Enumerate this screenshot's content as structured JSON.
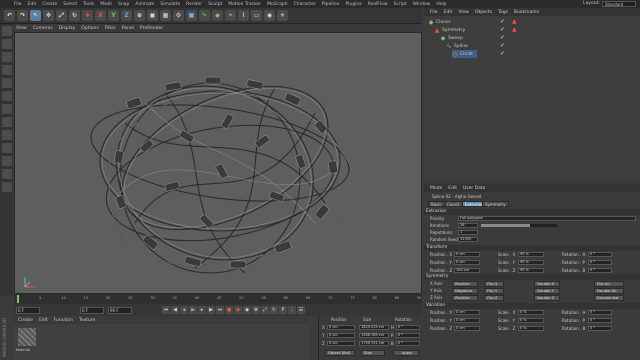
{
  "menubar": {
    "items": [
      "File",
      "Edit",
      "Create",
      "Select",
      "Tools",
      "Mesh",
      "Snap",
      "Animate",
      "Simulate",
      "Render",
      "Sculpt",
      "Motion Tracker",
      "MoGraph",
      "Character",
      "Pipeline",
      "Plugins",
      "RealFlow",
      "Script",
      "Window",
      "Help"
    ],
    "layout_label": "Layout:",
    "layout_value": "Standard"
  },
  "toolbar": {
    "axis_x": "X",
    "axis_y": "Y",
    "axis_z": "Z"
  },
  "viewport": {
    "menu": [
      "View",
      "Cameras",
      "Display",
      "Options",
      "Filter",
      "Panel",
      "ProRender"
    ]
  },
  "timeline": {
    "ticks": [
      "0",
      "5",
      "10",
      "15",
      "20",
      "25",
      "30",
      "35",
      "40",
      "45",
      "50",
      "55",
      "60",
      "65",
      "70",
      "75",
      "80",
      "85",
      "90"
    ],
    "start_field": "0 F",
    "end_field": "90 F",
    "current_frame": "0 F"
  },
  "material": {
    "menu": [
      "Create",
      "Edit",
      "Function",
      "Texture"
    ],
    "name": "Material"
  },
  "coordinates": {
    "headers": [
      "Position",
      "Size",
      "Rotation"
    ],
    "rows": [
      {
        "axis": "X",
        "pos": "0 cm",
        "size": "1829.215 cm",
        "rot_label": "H",
        "rot": "0 °"
      },
      {
        "axis": "Y",
        "pos": "0 cm",
        "size": "1306.785 cm",
        "rot_label": "P",
        "rot": "0 °"
      },
      {
        "axis": "Z",
        "pos": "0 cm",
        "size": "1759.722 cm",
        "rot_label": "B",
        "rot": "0 °"
      }
    ],
    "mode": "Object (Rel)",
    "size_mode": "Size",
    "apply": "Apply"
  },
  "objects": {
    "menu": [
      "File",
      "Edit",
      "View",
      "Objects",
      "Tags",
      "Bookmarks"
    ],
    "rows": [
      {
        "name": "Cloner",
        "color": "#7cc46a"
      },
      {
        "name": "Symmetry",
        "color": "#e6533b"
      },
      {
        "name": "Sweep",
        "color": "#7cc46a"
      },
      {
        "name": "Spline",
        "color": "#7cc46a"
      },
      {
        "name": "Circle",
        "color": "#e6a23b"
      }
    ]
  },
  "attributes": {
    "menu": [
      "Mode",
      "Edit",
      "User Data"
    ],
    "object_title": "Spline X2 - Alpha Owned",
    "tabs": [
      "Basic",
      "Coord.",
      "Extrusion",
      "Symmetry"
    ],
    "active_tab": "Extrusion",
    "extrusion": {
      "section": "Extrusion",
      "priority_label": "Priority",
      "priority_value": "Full polygons",
      "iterations_label": "Iterations",
      "iterations_value": "26",
      "repetitions_label": "Repetitions",
      "repetitions_value": "1",
      "random_seed_label": "Random Seed",
      "random_seed_value": "12359"
    },
    "transform": {
      "section": "Transform",
      "rows": [
        {
          "pos_label": "Position . X",
          "pos": "0 cm",
          "scale_label": "Scale . X",
          "scale": "95 %",
          "rot_label": "Rotation . H",
          "rot": "0 °"
        },
        {
          "pos_label": "Position . Y",
          "pos": "0 cm",
          "scale_label": "Scale . Y",
          "scale": "95 %",
          "rot_label": "Rotation . P",
          "rot": "0 °"
        },
        {
          "pos_label": "Position . Z",
          "pos": "100 cm",
          "scale_label": "Scale . Z",
          "scale": "95 %",
          "rot_label": "Rotation . B",
          "rot": "0 °"
        }
      ]
    },
    "symmetry": {
      "section": "Symmetry",
      "rows": [
        {
          "label": "X Axis",
          "opt": "Positive",
          "flip": "Flip X",
          "double": "Double X",
          "flip_all": "Flip All"
        },
        {
          "label": "Y Axis",
          "opt": "Negative",
          "flip": "Flip Y",
          "double": "Double Y",
          "flip_all": "Double All"
        },
        {
          "label": "Z Axis",
          "opt": "Positive",
          "flip": "Flip Z",
          "double": "Double Z",
          "flip_all": "Randomize"
        }
      ]
    },
    "variation": {
      "section": "Variation",
      "rows": [
        {
          "pos_label": "Position . X",
          "pos": "0 cm",
          "scale_label": "Scale . X",
          "scale": "0 %",
          "rot_label": "Rotation . H",
          "rot": "0 °"
        },
        {
          "pos_label": "Position . Y",
          "pos": "0 cm",
          "scale_label": "Scale . Y",
          "scale": "0 %",
          "rot_label": "Rotation . P",
          "rot": "0 °"
        },
        {
          "pos_label": "Position . Z",
          "pos": "0 cm",
          "scale_label": "Scale . Z",
          "scale": "0 %",
          "rot_label": "Rotation . B",
          "rot": "0 °"
        }
      ]
    }
  },
  "brand": "MAXON CINEMA 4D"
}
